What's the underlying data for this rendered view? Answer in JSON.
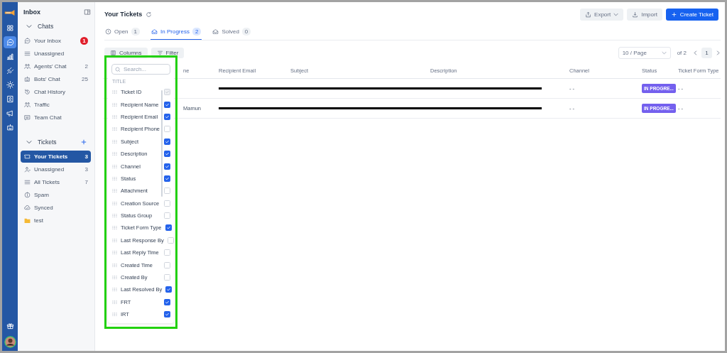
{
  "rail": {
    "items": [
      {
        "kind": "grid",
        "selected": false
      },
      {
        "kind": "chat",
        "selected": true
      },
      {
        "kind": "chart",
        "selected": false
      },
      {
        "kind": "plug",
        "selected": false
      },
      {
        "kind": "gear",
        "selected": false
      },
      {
        "kind": "contact",
        "selected": false
      },
      {
        "kind": "megaphone",
        "selected": false
      },
      {
        "kind": "bot",
        "selected": false
      }
    ]
  },
  "sidebar": {
    "title": "Inbox",
    "sections": [
      {
        "title": "Chats",
        "expanded": true,
        "items": [
          {
            "label": "Your Inbox",
            "count": "1",
            "alert": true,
            "selected": false,
            "kind": "chat"
          },
          {
            "label": "Unassigned",
            "selected": false,
            "kind": "list"
          },
          {
            "label": "Agents' Chat",
            "count": "2",
            "alert": false,
            "selected": false,
            "kind": "people"
          },
          {
            "label": "Bots' Chat",
            "count": "25",
            "alert": false,
            "selected": false,
            "kind": "bot"
          },
          {
            "label": "Chat History",
            "selected": false,
            "kind": "history"
          },
          {
            "label": "Traffic",
            "selected": false,
            "kind": "people"
          },
          {
            "label": "Team Chat",
            "selected": false,
            "kind": "message"
          }
        ]
      },
      {
        "title": "Tickets",
        "expanded": true,
        "add": true,
        "items": [
          {
            "label": "Your Tickets",
            "count": "3",
            "alert": false,
            "selected": true,
            "kind": "ticket"
          },
          {
            "label": "Unassigned",
            "count": "3",
            "alert": false,
            "selected": false,
            "kind": "person"
          },
          {
            "label": "All Tickets",
            "count": "7",
            "alert": false,
            "selected": false,
            "kind": "list"
          },
          {
            "label": "Spam",
            "selected": false,
            "kind": "info"
          },
          {
            "label": "Synced",
            "selected": false,
            "kind": "cloud"
          },
          {
            "label": "test",
            "selected": false,
            "kind": "folder"
          }
        ]
      }
    ]
  },
  "header": {
    "title": "Your Tickets",
    "actions": [
      {
        "label": "Export",
        "kind": "export"
      },
      {
        "label": "Import",
        "kind": "import"
      },
      {
        "label": "Create Ticket",
        "kind": "create"
      }
    ]
  },
  "tabs": [
    {
      "label": "Open",
      "count": "1",
      "selected": false,
      "kind": "clock"
    },
    {
      "label": "In Progress",
      "count": "2",
      "selected": true,
      "kind": "mail"
    },
    {
      "label": "Solved",
      "count": "0",
      "selected": false,
      "kind": "mail"
    }
  ],
  "toolbar": {
    "buttons": [
      {
        "label": "Columns",
        "kind": "columns"
      },
      {
        "label": "Filter",
        "kind": "filter"
      }
    ],
    "page_size": "10 / Page",
    "page_total": "of 2",
    "page": "1"
  },
  "table": {
    "columns": [
      "ne",
      "Recipient Email",
      "Subject",
      "Description",
      "Channel",
      "Status",
      "Ticket Form Type"
    ],
    "rows": [
      {
        "cells": [
          {
            "kind": "empty"
          },
          {
            "kind": "redacted"
          },
          {
            "kind": "redacted"
          },
          {
            "kind": "redacted"
          },
          {
            "kind": "text",
            "text": "- -"
          },
          {
            "kind": "status",
            "text": "IN PROGRE..."
          },
          {
            "kind": "text",
            "text": "- -"
          }
        ]
      },
      {
        "cells": [
          {
            "kind": "text",
            "text": "Mamun"
          },
          {
            "kind": "redacted"
          },
          {
            "kind": "redacted"
          },
          {
            "kind": "redacted"
          },
          {
            "kind": "text",
            "text": "- -"
          },
          {
            "kind": "status",
            "text": "IN PROGRE..."
          },
          {
            "kind": "text",
            "text": "- -"
          }
        ]
      }
    ]
  },
  "columns_menu": {
    "placeholder": "Search...",
    "heading": "TITLE",
    "items": [
      {
        "label": "Ticket ID",
        "checked": true,
        "disabled": true
      },
      {
        "label": "Recipient Name",
        "checked": true,
        "disabled": false
      },
      {
        "label": "Recipient Email",
        "checked": true,
        "disabled": false
      },
      {
        "label": "Recipient Phone",
        "checked": false,
        "disabled": false
      },
      {
        "label": "Subject",
        "checked": true,
        "disabled": false
      },
      {
        "label": "Description",
        "checked": true,
        "disabled": false
      },
      {
        "label": "Channel",
        "checked": true,
        "disabled": false
      },
      {
        "label": "Status",
        "checked": true,
        "disabled": false
      },
      {
        "label": "Attachment",
        "checked": false,
        "disabled": false
      },
      {
        "label": "Creation Source",
        "checked": false,
        "disabled": false
      },
      {
        "label": "Status Group",
        "checked": false,
        "disabled": false
      },
      {
        "label": "Ticket Form Type",
        "checked": true,
        "disabled": false
      },
      {
        "label": "Last Response By",
        "checked": false,
        "disabled": false
      },
      {
        "label": "Last Reply Time",
        "checked": false,
        "disabled": false
      },
      {
        "label": "Created Time",
        "checked": false,
        "disabled": false
      },
      {
        "label": "Created By",
        "checked": false,
        "disabled": false
      },
      {
        "label": "Last Resolved By",
        "checked": true,
        "disabled": false
      },
      {
        "label": "FRT",
        "checked": true,
        "disabled": false
      },
      {
        "label": "IRT",
        "checked": true,
        "disabled": false
      }
    ]
  }
}
